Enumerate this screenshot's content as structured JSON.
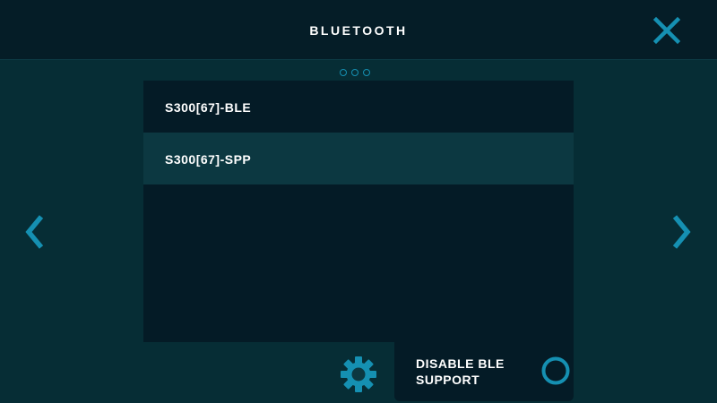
{
  "header": {
    "title": "BLUETOOTH",
    "close_icon": "close-icon"
  },
  "pager": {
    "page_count": 3,
    "icon": "pagination-dots"
  },
  "device_list": {
    "items": [
      {
        "label": "S300[67]-BLE",
        "selected": false
      },
      {
        "label": "S300[67]-SPP",
        "selected": true
      }
    ]
  },
  "nav": {
    "prev_icon": "chevron-left-icon",
    "next_icon": "chevron-right-icon"
  },
  "settings": {
    "icon": "gear-icon"
  },
  "ble_toggle": {
    "label": "DISABLE BLE SUPPORT",
    "checked": false
  },
  "colors": {
    "background": "#062d35",
    "header_bg": "#051d27",
    "panel_bg": "#041b26",
    "row_selected_bg": "#0c3841",
    "accent": "#1590b2",
    "text": "#ffffff"
  }
}
